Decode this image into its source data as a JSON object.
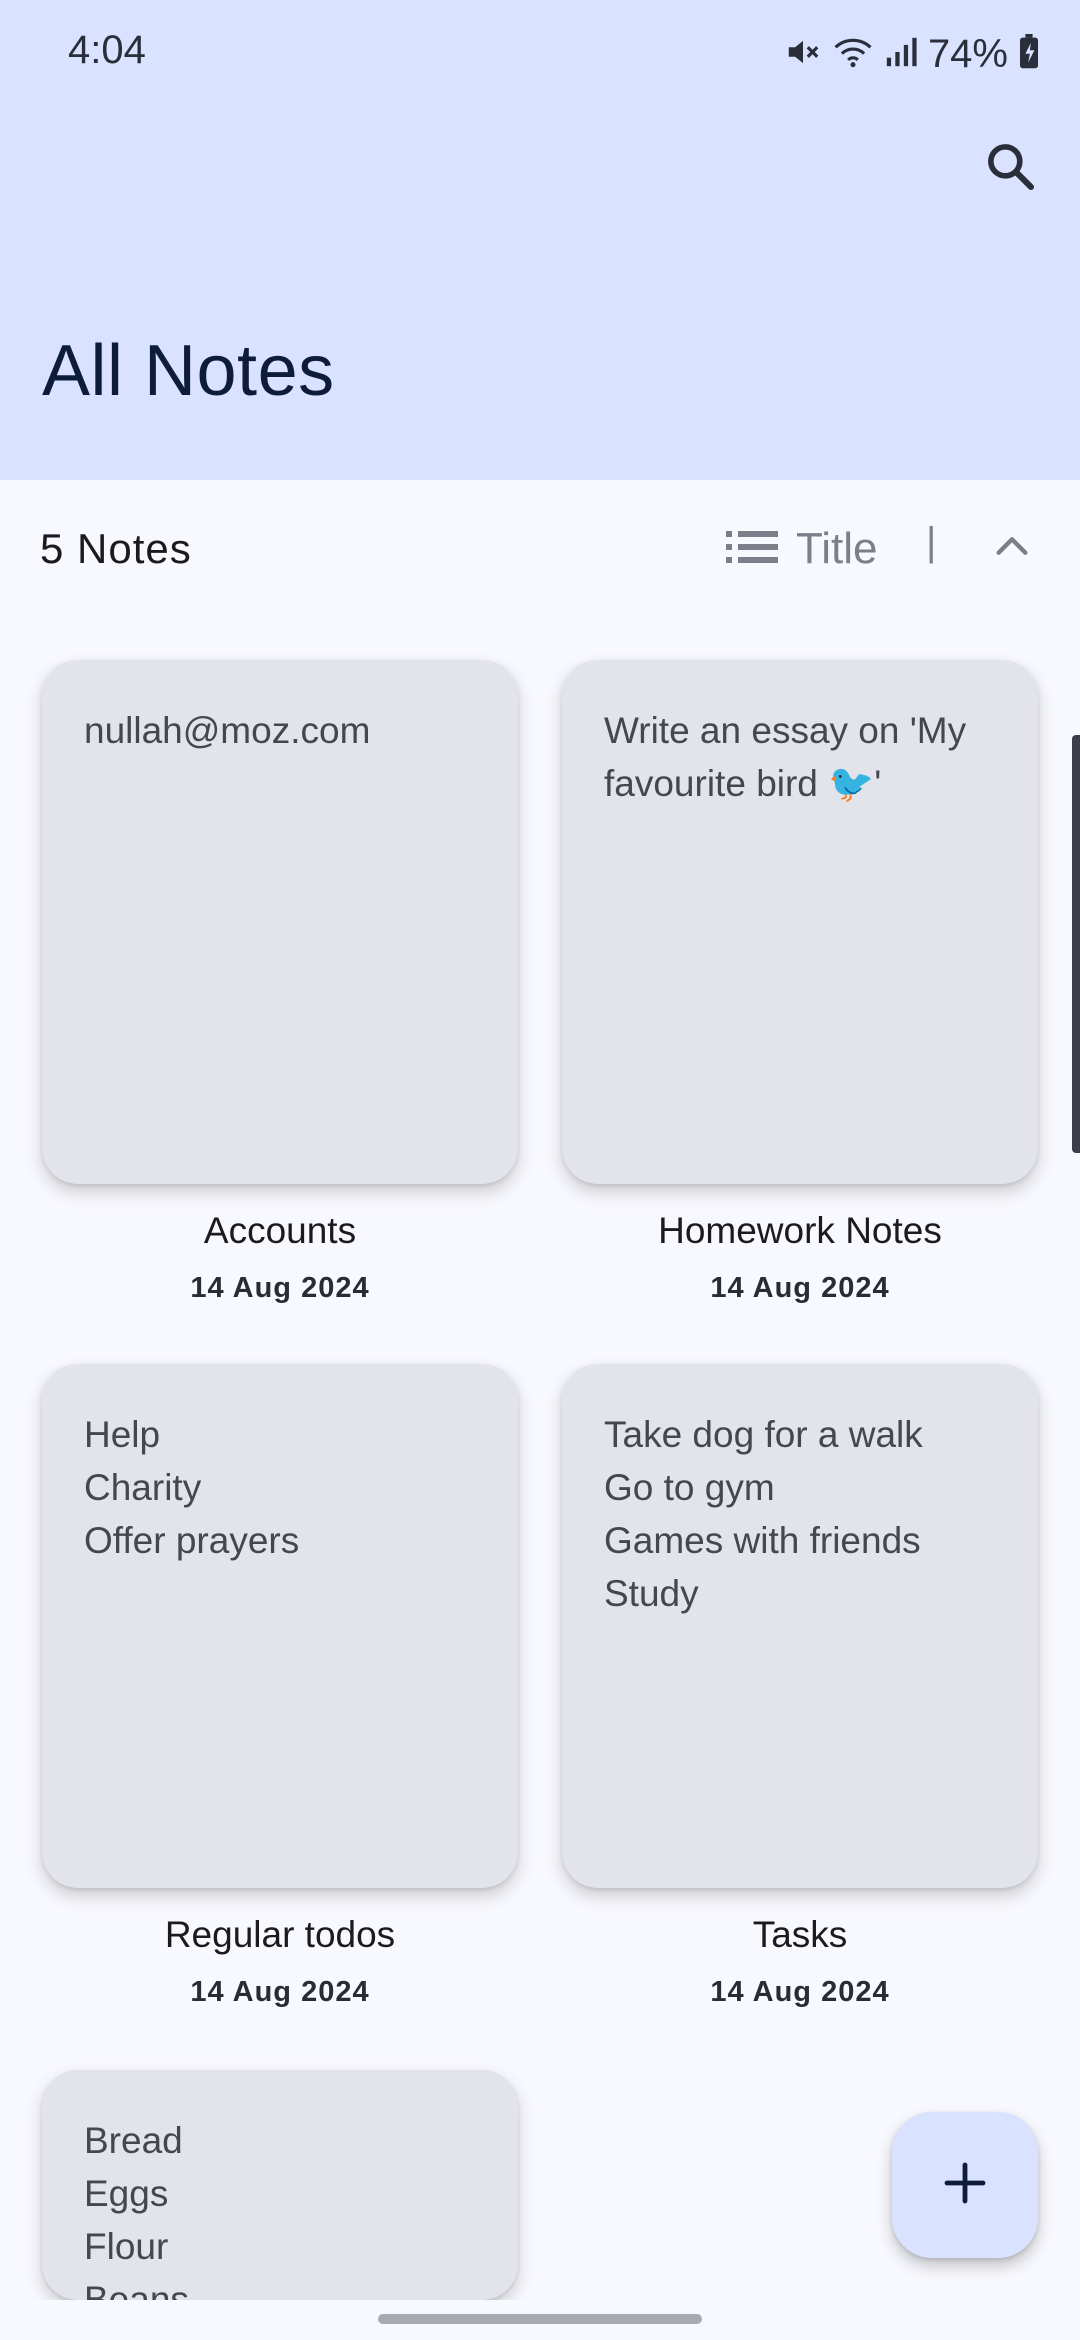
{
  "status_bar": {
    "time": "4:04",
    "battery": "74%",
    "icons": [
      "mute-icon",
      "wifi-icon",
      "signal-icon",
      "battery-icon"
    ]
  },
  "header": {
    "title": "All Notes",
    "search_icon": "search-icon",
    "background": "#D9E2FE"
  },
  "toolbar": {
    "count_label": "5 Notes",
    "sort_icon": "list-icon",
    "sort_label": "Title",
    "divider": "|",
    "direction_icon": "chevron-up-icon"
  },
  "notes": [
    {
      "body": "nullah@moz.com",
      "title": "Accounts",
      "date": "14 Aug 2024"
    },
    {
      "body": "Write an essay on 'My favourite bird 🐦'",
      "title": "Homework Notes",
      "date": "14 Aug 2024"
    },
    {
      "body": "Help\nCharity\nOffer prayers",
      "title": "Regular todos",
      "date": "14 Aug 2024"
    },
    {
      "body": "Take dog for a walk\nGo to gym\nGames with friends\nStudy",
      "title": "Tasks",
      "date": "14 Aug 2024"
    },
    {
      "body": "Bread\nEggs\nFlour\nBeans"
    }
  ],
  "fab": {
    "icon": "plus-icon",
    "background": "#D9E2FE"
  },
  "colors": {
    "card": "#E3E3EB",
    "page_background": "#F8F9FE",
    "title_text": "#0E1C3C"
  }
}
